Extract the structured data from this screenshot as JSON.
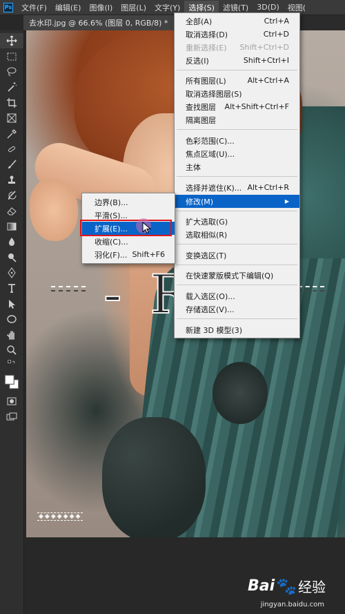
{
  "menubar": {
    "logo": "Ps",
    "items": [
      "文件(F)",
      "编辑(E)",
      "图像(I)",
      "图层(L)",
      "文字(Y)",
      "选择(S)",
      "滤镜(T)",
      "3D(D)",
      "视图("
    ],
    "active_index": 5
  },
  "document": {
    "tab_title": "去水印.jpg @ 66.6% (图层 0, RGB/8) *",
    "close_glyph": "×"
  },
  "toolbar": {
    "tools": [
      "move-icon",
      "marquee-icon",
      "lasso-icon",
      "magic-wand-icon",
      "crop-icon",
      "frame-icon",
      "eyedropper-icon",
      "healing-brush-icon",
      "brush-icon",
      "clone-stamp-icon",
      "history-brush-icon",
      "eraser-icon",
      "gradient-icon",
      "blur-icon",
      "dodge-icon",
      "pen-icon",
      "type-icon",
      "path-selection-icon",
      "ellipse-icon",
      "hand-icon",
      "zoom-icon"
    ]
  },
  "canvas": {
    "watermark_text": "- RU",
    "watermark_small": "◆◆◆◆◆◆◆"
  },
  "select_menu": {
    "items": [
      {
        "label": "全部(A)",
        "shortcut": "Ctrl+A",
        "disabled": false
      },
      {
        "label": "取消选择(D)",
        "shortcut": "Ctrl+D",
        "disabled": false
      },
      {
        "label": "重新选择(E)",
        "shortcut": "Shift+Ctrl+D",
        "disabled": true
      },
      {
        "label": "反选(I)",
        "shortcut": "Shift+Ctrl+I",
        "disabled": false
      },
      {
        "label": "所有图层(L)",
        "shortcut": "Alt+Ctrl+A",
        "disabled": false
      },
      {
        "label": "取消选择图层(S)",
        "shortcut": "",
        "disabled": false
      },
      {
        "label": "查找图层",
        "shortcut": "Alt+Shift+Ctrl+F",
        "disabled": false
      },
      {
        "label": "隔离图层",
        "shortcut": "",
        "disabled": false
      },
      {
        "label": "色彩范围(C)...",
        "shortcut": "",
        "disabled": false
      },
      {
        "label": "焦点区域(U)...",
        "shortcut": "",
        "disabled": false
      },
      {
        "label": "主体",
        "shortcut": "",
        "disabled": false
      },
      {
        "label": "选择并遮住(K)...",
        "shortcut": "Alt+Ctrl+R",
        "disabled": false
      },
      {
        "label": "修改(M)",
        "shortcut": "",
        "disabled": false,
        "submenu": true
      },
      {
        "label": "扩大选取(G)",
        "shortcut": "",
        "disabled": false
      },
      {
        "label": "选取相似(R)",
        "shortcut": "",
        "disabled": false
      },
      {
        "label": "变换选区(T)",
        "shortcut": "",
        "disabled": false
      },
      {
        "label": "在快速蒙版模式下编辑(Q)",
        "shortcut": "",
        "disabled": false
      },
      {
        "label": "载入选区(O)...",
        "shortcut": "",
        "disabled": false
      },
      {
        "label": "存储选区(V)...",
        "shortcut": "",
        "disabled": false
      },
      {
        "label": "新建 3D 模型(3)",
        "shortcut": "",
        "disabled": false
      }
    ],
    "highlighted_index": 12,
    "submenu_arrow": "▶"
  },
  "modify_submenu": {
    "items": [
      {
        "label": "边界(B)...",
        "shortcut": ""
      },
      {
        "label": "平滑(S)...",
        "shortcut": ""
      },
      {
        "label": "扩展(E)...",
        "shortcut": ""
      },
      {
        "label": "收缩(C)...",
        "shortcut": ""
      },
      {
        "label": "羽化(F)...",
        "shortcut": "Shift+F6"
      }
    ],
    "highlighted_index": 2
  },
  "baidu": {
    "brand_left": "Bai",
    "paw": "🐾",
    "brand_right": "经验",
    "url": "jingyan.baidu.com"
  },
  "colors": {
    "menu_highlight": "#0a64c8",
    "red_annotation": "#e0151b"
  }
}
